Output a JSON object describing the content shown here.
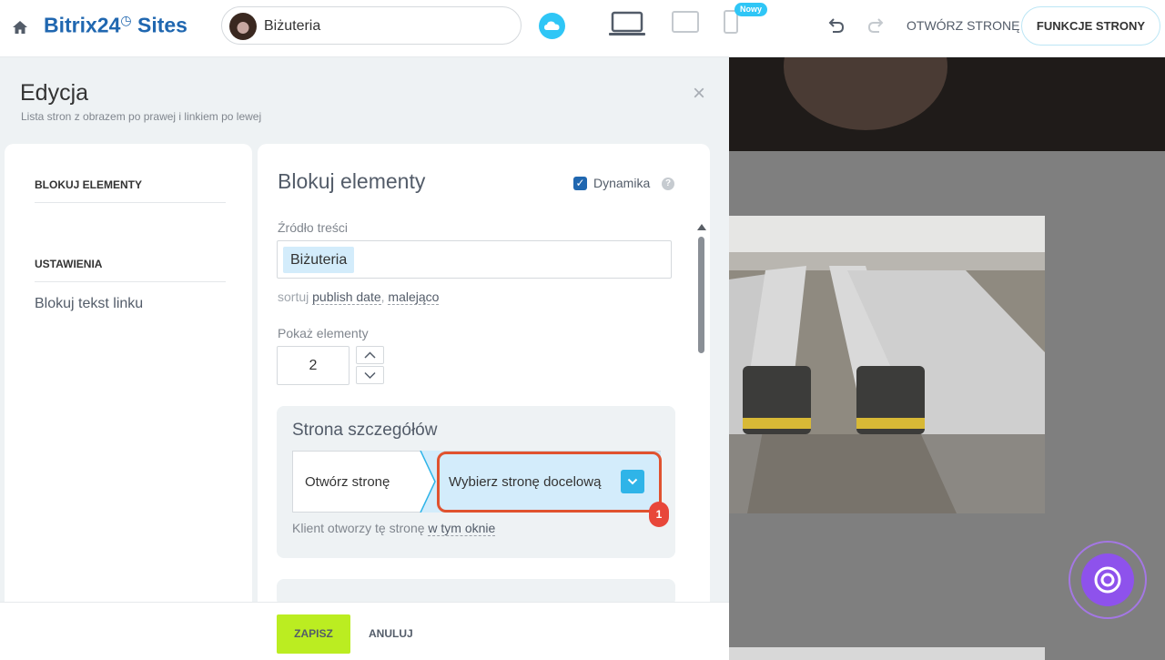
{
  "header": {
    "logo": {
      "brand": "Bitrix24",
      "clock": "◷",
      "suffix": " Sites"
    },
    "site_name": "Biżuteria",
    "new_badge": "Nowy",
    "open_page_label": "OTWÓRZ STRONĘ",
    "page_functions_label": "FUNKCJE STRONY"
  },
  "editor": {
    "title": "Edycja",
    "subtitle": "Lista stron z obrazem po prawej i linkiem po lewej",
    "close_icon": "×",
    "nav": {
      "block_elements_heading": "BLOKUJ ELEMENTY",
      "settings_heading": "USTAWIENIA",
      "link_text_item": "Blokuj tekst linku"
    },
    "form": {
      "title": "Blokuj elementy",
      "dynamic_label": "Dynamika",
      "dynamic_checked": true,
      "help_icon": "?",
      "source_label": "Źródło treści",
      "source_value": "Biżuteria",
      "sort_prefix": "sortuj",
      "sort_field": "publish date",
      "sort_sep": ",",
      "sort_order": "malejąco",
      "show_label": "Pokaż elementy",
      "show_count": "2",
      "detail": {
        "title": "Strona szczegółów",
        "action_label": "Otwórz stronę",
        "target_label": "Wybierz stronę docelową",
        "callout_number": "1",
        "client_prefix": "Klient otworzy tę stronę",
        "client_link": "w tym oknie"
      }
    },
    "footer": {
      "save_label": "ZAPISZ",
      "cancel_label": "ANULUJ"
    }
  },
  "colors": {
    "brand_blue": "#2067b0",
    "accent_cyan": "#2fc6f6",
    "save_green": "#bbed21",
    "callout_red": "#e0522f",
    "assistant_purple": "#8e52ec"
  }
}
